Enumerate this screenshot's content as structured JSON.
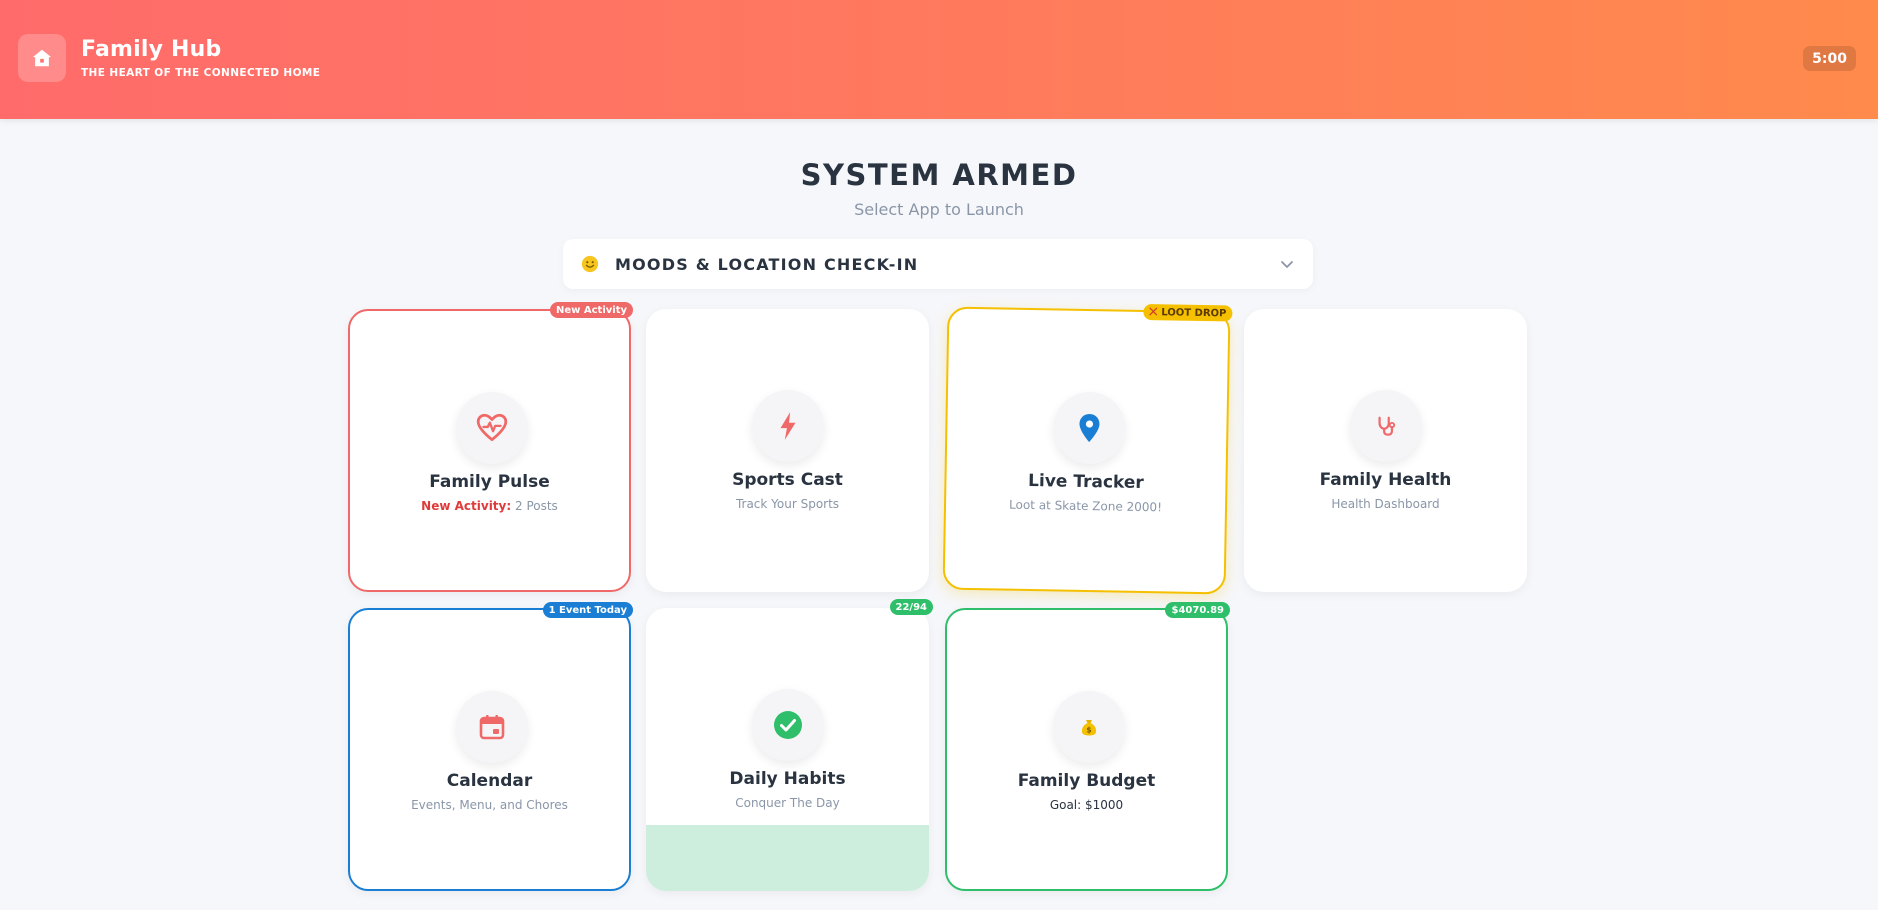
{
  "header": {
    "title": "Family Hub",
    "subtitle": "THE HEART OF THE CONNECTED HOME",
    "timer": "5:00",
    "logo_icon": "home-icon"
  },
  "main": {
    "title": "SYSTEM ARMED",
    "subtitle": "Select App to Launch"
  },
  "mood": {
    "label": "MOODS & LOCATION CHECK-IN",
    "icon": "smiley-icon"
  },
  "cards": {
    "pulse": {
      "title": "Family Pulse",
      "sub_prefix": "New Activity:",
      "sub_value": "2 Posts",
      "badge": "New Activity",
      "icon": "heart-pulse-icon",
      "color": "#f06969"
    },
    "sports": {
      "title": "Sports Cast",
      "sub": "Track Your Sports",
      "icon": "lightning-icon",
      "color": "#f06969"
    },
    "tracker": {
      "title": "Live Tracker",
      "sub": "Loot at Skate Zone 2000!",
      "badge": "LOOT DROP",
      "icon": "location-pin-icon",
      "color": "#f5c000"
    },
    "health": {
      "title": "Family Health",
      "sub": "Health Dashboard",
      "icon": "stethoscope-icon",
      "color": "#f06969"
    },
    "calendar": {
      "title": "Calendar",
      "sub": "Events, Menu, and Chores",
      "badge": "1 Event Today",
      "icon": "calendar-icon",
      "color": "#1a7fd4"
    },
    "habits": {
      "title": "Daily Habits",
      "sub": "Conquer The Day",
      "badge": "22/94",
      "icon": "check-circle-icon",
      "color": "#2fbf6a",
      "progress": 0.234
    },
    "budget": {
      "title": "Family Budget",
      "sub": "Goal: $1000",
      "badge": "$4070.89",
      "icon": "money-bag-icon",
      "color": "#2fbf6a"
    }
  }
}
